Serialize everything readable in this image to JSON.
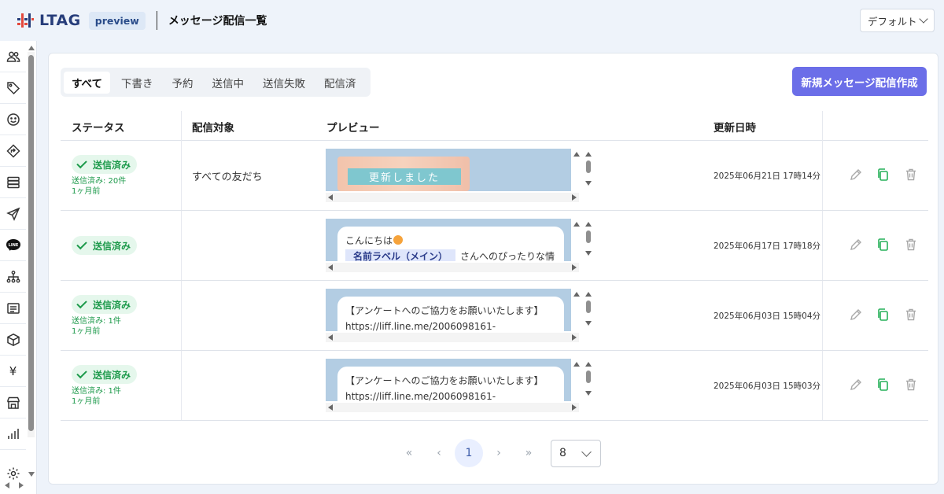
{
  "header": {
    "logo_text": "LTAG",
    "badge": "preview",
    "title": "メッセージ配信一覧",
    "view_select": "デフォルト"
  },
  "sidebar": {
    "items": [
      {
        "icon": "friends-icon"
      },
      {
        "icon": "tag-icon"
      },
      {
        "icon": "smile-icon"
      },
      {
        "icon": "diamond-arrow-icon"
      },
      {
        "icon": "database-icon"
      },
      {
        "icon": "send-icon"
      },
      {
        "icon": "line-icon",
        "label": "LINE"
      },
      {
        "icon": "hierarchy-icon"
      },
      {
        "icon": "list-icon"
      },
      {
        "icon": "box-icon"
      },
      {
        "icon": "yen-icon",
        "label": "¥"
      },
      {
        "icon": "store-icon"
      },
      {
        "icon": "chart-icon"
      },
      {
        "icon": "settings-icon"
      }
    ]
  },
  "tabs": [
    "すべて",
    "下書き",
    "予約",
    "送信中",
    "送信失敗",
    "配信済"
  ],
  "new_button": "新規メッセージ配信作成",
  "table": {
    "headers": {
      "status": "ステータス",
      "target": "配信対象",
      "preview": "プレビュー",
      "updated": "更新日時"
    },
    "rows": [
      {
        "status": "送信済み",
        "sent": "送信済み: 20件",
        "ago": "1ヶ月前",
        "target": "すべての友だち",
        "preview_banner": "更新しました",
        "updated": "2025年06月21日 17時14分"
      },
      {
        "status": "送信済み",
        "sent": "",
        "ago": "",
        "target": "",
        "preview_line1": "こんにちは",
        "preview_label": "名前ラベル（メイン）",
        "preview_line2": "さんへのぴったりな情",
        "updated": "2025年06月17日 17時18分"
      },
      {
        "status": "送信済み",
        "sent": "送信済み: 1件",
        "ago": "1ヶ月前",
        "target": "",
        "preview_line1": "【アンケートへのご協力をお願いいたします】",
        "preview_line2": "https://liff.line.me/2006098161-",
        "updated": "2025年06月03日 15時04分"
      },
      {
        "status": "送信済み",
        "sent": "送信済み: 1件",
        "ago": "1ヶ月前",
        "target": "",
        "preview_line1": "【アンケートへのご協力をお願いいたします】",
        "preview_line2": "https://liff.line.me/2006098161-",
        "updated": "2025年06月03日 15時03分"
      }
    ]
  },
  "pagination": {
    "first": "«",
    "prev": "‹",
    "current": "1",
    "next": "›",
    "last": "»",
    "per_page": "8"
  },
  "colors": {
    "accent": "#6b6ee8",
    "status_green": "#1d9a4b",
    "logo_red": "#e4483c",
    "logo_navy": "#273d7a"
  }
}
